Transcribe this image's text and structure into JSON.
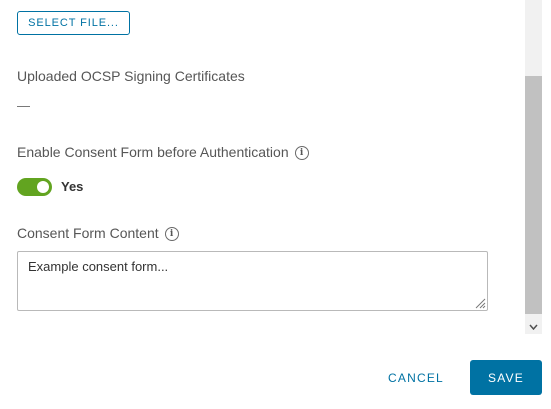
{
  "upload": {
    "select_file_label": "SELECT FILE..."
  },
  "ocsp": {
    "label": "Uploaded OCSP Signing Certificates",
    "empty_value": "—"
  },
  "consent_toggle": {
    "label": "Enable Consent Form before Authentication",
    "info_icon": "i",
    "state": true,
    "state_label": "Yes",
    "on_color": "#62a420"
  },
  "consent_content": {
    "label": "Consent Form Content",
    "info_icon": "i",
    "value": "Example consent form..."
  },
  "footer": {
    "cancel_label": "CANCEL",
    "save_label": "SAVE"
  },
  "colors": {
    "primary": "#0072a3",
    "toggle_on": "#62a420"
  }
}
